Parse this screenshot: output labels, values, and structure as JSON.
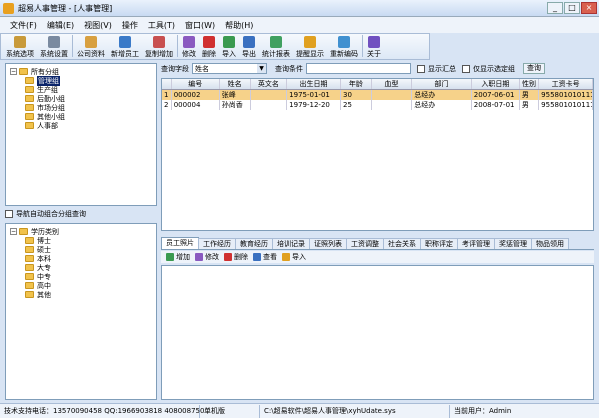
{
  "window": {
    "title": "超易人事管理 - [人事管理]",
    "minimize": "_",
    "maximize": "□",
    "close": "×"
  },
  "menu": [
    "文件(F)",
    "编辑(E)",
    "视图(V)",
    "操作",
    "工具(T)",
    "窗口(W)",
    "帮助(H)"
  ],
  "toolbar": [
    {
      "label": "系统选项",
      "color": "#c89a3a"
    },
    {
      "label": "系统设置",
      "color": "#7a8aa0"
    },
    {
      "label": "公司资料",
      "color": "#d8a040"
    },
    {
      "label": "新增员工",
      "color": "#3a7ac8"
    },
    {
      "label": "复制增加",
      "color": "#c85050"
    },
    {
      "label": "修改",
      "color": "#8a5ac0"
    },
    {
      "label": "删除",
      "color": "#d03030"
    },
    {
      "label": "导入",
      "color": "#3a9a50"
    },
    {
      "label": "导出",
      "color": "#3a70c0"
    },
    {
      "label": "统计报表",
      "color": "#40a060"
    },
    {
      "label": "提醒显示",
      "color": "#e0a020"
    },
    {
      "label": "重新编码",
      "color": "#4090d0"
    },
    {
      "label": "关于",
      "color": "#7050c0"
    }
  ],
  "tree1": {
    "root": "所有分组",
    "items": [
      "管理组",
      "生产组",
      "后勤小组",
      "市场分组",
      "其他小组",
      "人事部"
    ],
    "selected": "管理组"
  },
  "nav_check_label": "导航自动组合分组查询",
  "tree2": {
    "root": "学历类别",
    "items": [
      "博士",
      "硕士",
      "本科",
      "大专",
      "中专",
      "高中",
      "其他"
    ]
  },
  "query": {
    "field_label": "查询字段",
    "field_value": "姓名",
    "cond_label": "查询条件",
    "show_summary": "显示汇总",
    "only_selected": "仅显示选定组",
    "query_button": "查询"
  },
  "grid": {
    "columns": [
      "",
      "编号",
      "姓名",
      "英文名",
      "出生日期",
      "年龄",
      "血型",
      "部门",
      "入职日期",
      "性别",
      "工资卡号"
    ],
    "rows": [
      [
        "1",
        "000002",
        "张峰",
        "",
        "1975-01-01",
        "30",
        "",
        "总经办",
        "2007-06-01",
        "男",
        "9558010101111"
      ],
      [
        "2",
        "000004",
        "孙尚香",
        "",
        "1979-12-20",
        "25",
        "",
        "总经办",
        "2008-07-01",
        "男",
        "9558010101115"
      ]
    ]
  },
  "tabs": [
    "员工照片",
    "工作经历",
    "教育经历",
    "培训记录",
    "证照列表",
    "工资调整",
    "社会关系",
    "职称评定",
    "考评管理",
    "奖惩管理",
    "物品领用"
  ],
  "subtoolbar": [
    "增加",
    "修改",
    "删除",
    "查看",
    "导入"
  ],
  "status": [
    "技术支持电话：13570090458 QQ:1966903818 408008750",
    "单机版",
    "C:\\超易软件\\超易人事管理\\xyhUdate.sys",
    "当前用户：Admin"
  ]
}
